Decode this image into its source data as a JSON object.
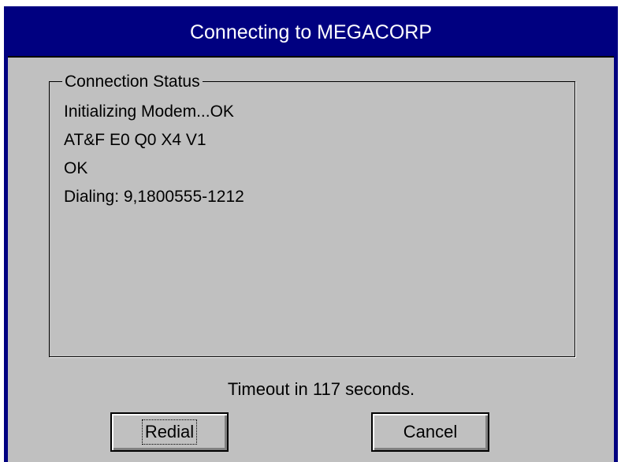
{
  "window": {
    "title": "Connecting to MEGACORP"
  },
  "status_group": {
    "label": "Connection Status",
    "lines": [
      "Initializing Modem...OK",
      "AT&F E0 Q0 X4 V1",
      "OK",
      "Dialing: 9,1800555-1212"
    ]
  },
  "timeout": {
    "text": "Timeout in 117 seconds."
  },
  "buttons": {
    "redial_label": "Redial",
    "cancel_label": "Cancel"
  },
  "colors": {
    "titlebar": "#000080",
    "face": "#c0c0c0",
    "title_text": "#ffffff"
  }
}
